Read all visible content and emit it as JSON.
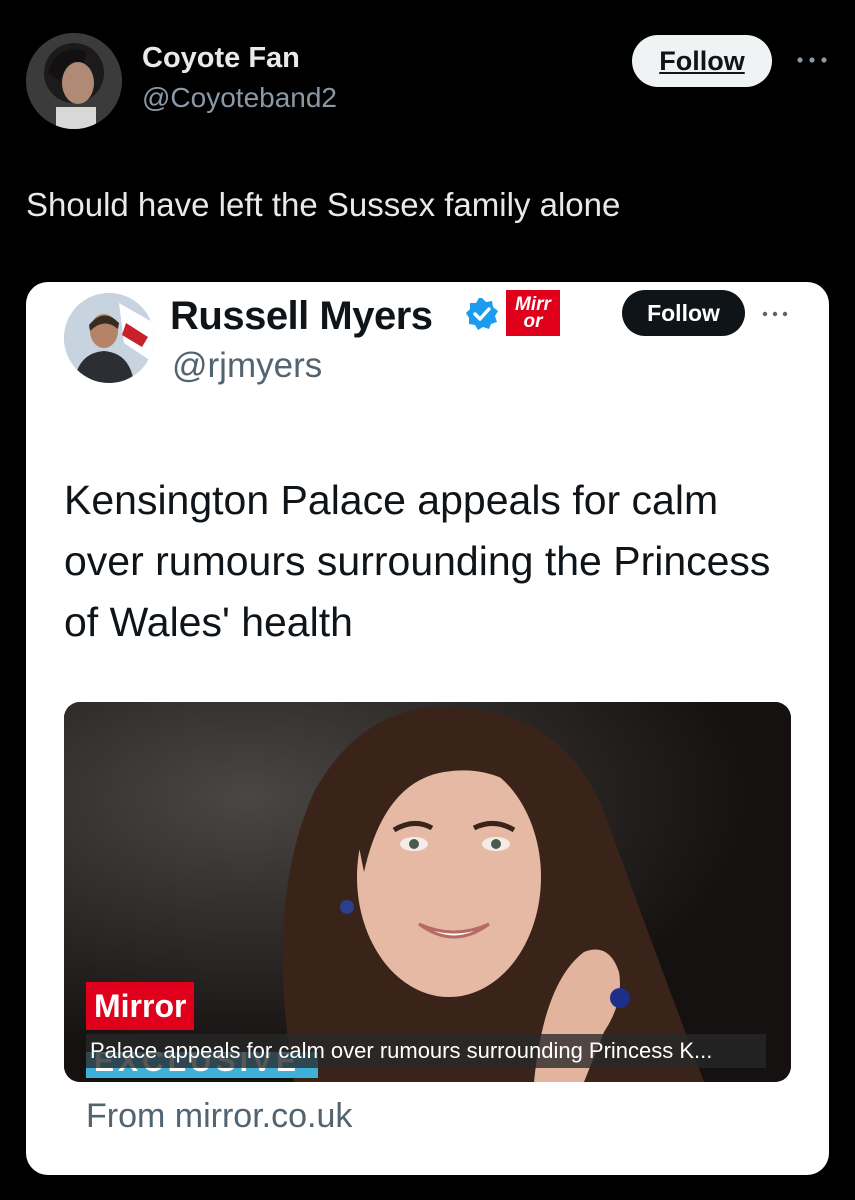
{
  "post": {
    "author_name": "Coyote Fan",
    "author_handle": "@Coyoteband2",
    "follow_label": "Follow",
    "text": "Should have left the Sussex family alone"
  },
  "quoted": {
    "author_name": "Russell Myers",
    "author_handle": "@rjmyers",
    "badge_line1": "Mirr",
    "badge_line2": "or",
    "follow_label": "Follow",
    "text": "Kensington Palace appeals for calm over rumours surrounding the Princess of Wales' health",
    "media": {
      "brand": "Mirror",
      "caption": "Palace appeals for calm over rumours surrounding Princess K...",
      "tag": "EXCLUSIVE"
    },
    "source": "From mirror.co.uk"
  },
  "colors": {
    "background": "#000000",
    "card": "#ffffff",
    "verified": "#1d9bf0",
    "mirror_red": "#e0001b"
  }
}
